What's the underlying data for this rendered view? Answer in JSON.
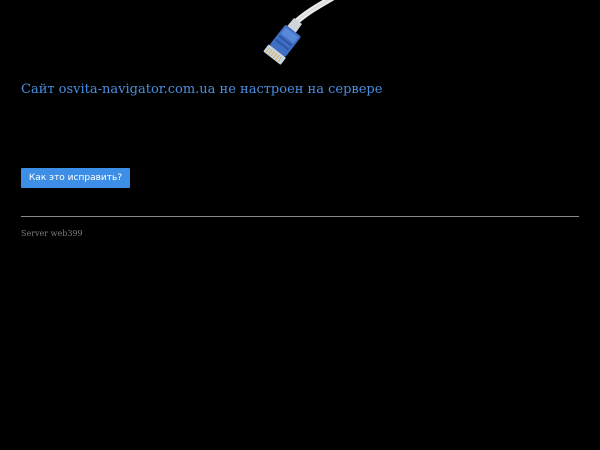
{
  "illustration": {
    "icon": "network-cable-icon"
  },
  "message": {
    "title": "Сайт osvita-navigator.com.ua не настроен на сервере"
  },
  "actions": {
    "fix_label": "Как это исправить?"
  },
  "footer": {
    "server_label": "Server web399"
  },
  "colors": {
    "background": "#000000",
    "title": "#4a8fe0",
    "button": "#3d8ee6",
    "divider": "#8a8a8a",
    "footer_text": "#7a7a7a"
  }
}
